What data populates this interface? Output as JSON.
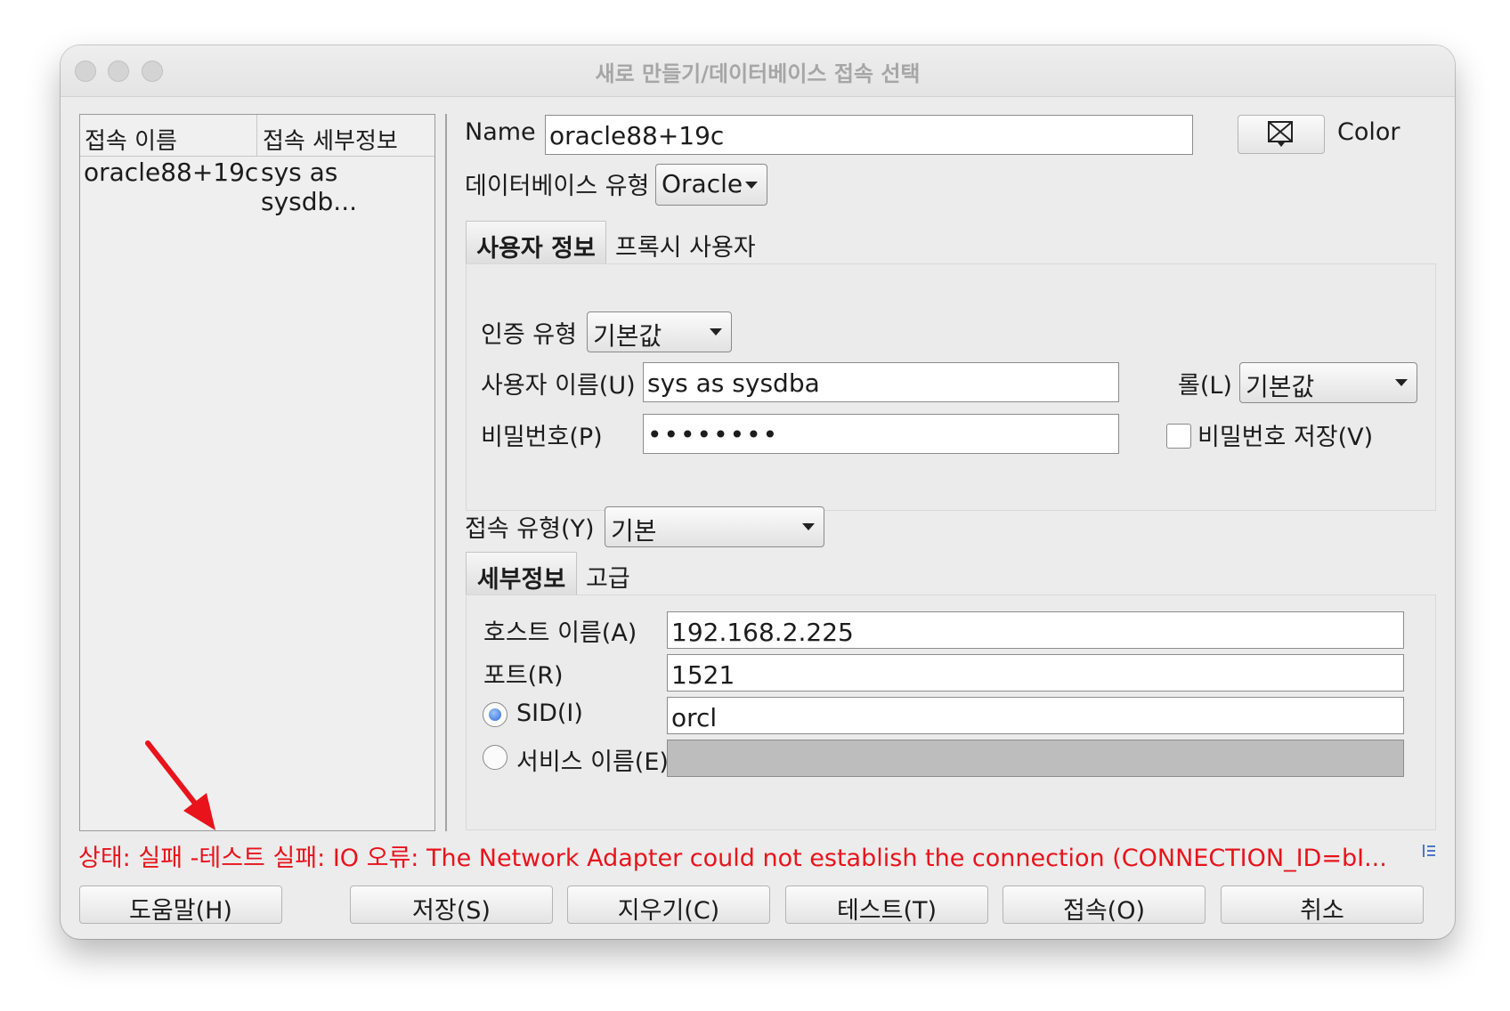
{
  "window": {
    "title": "새로 만들기/데이터베이스 접속 선택"
  },
  "connection_list": {
    "columns": [
      "접속 이름",
      "접속 세부정보"
    ],
    "rows": [
      {
        "name": "oracle88+19c",
        "details": "sys as sysdb..."
      }
    ]
  },
  "form": {
    "name_label": "Name",
    "name_value": "oracle88+19c",
    "color_label": "Color",
    "db_type_label": "데이터베이스 유형",
    "db_type_value": "Oracle",
    "tabs": [
      "사용자 정보",
      "프록시 사용자"
    ],
    "auth_type_label": "인증 유형",
    "auth_type_value": "기본값",
    "username_label": "사용자 이름(U)",
    "username_value": "sys as sysdba",
    "role_label": "롤(L)",
    "role_value": "기본값",
    "password_label": "비밀번호(P)",
    "password_value": "••••••••",
    "save_password_label": "비밀번호 저장(V)",
    "connection_type_label": "접속 유형(Y)",
    "connection_type_value": "기본",
    "detail_tabs": [
      "세부정보",
      "고급"
    ],
    "host_label": "호스트 이름(A)",
    "host_value": "192.168.2.225",
    "port_label": "포트(R)",
    "port_value": "1521",
    "sid_label": "SID(I)",
    "sid_value": "orcl",
    "service_label": "서비스 이름(E)",
    "service_value": ""
  },
  "status": {
    "text": "상태: 실패 -테스트 실패: IO 오류: The Network Adapter could not establish the connection (CONNECTION_ID=bI...",
    "color": "#e8131b"
  },
  "buttons": {
    "help": "도움말(H)",
    "save": "저장(S)",
    "clear": "지우기(C)",
    "test": "테스트(T)",
    "connect": "접속(O)",
    "cancel": "취소"
  }
}
